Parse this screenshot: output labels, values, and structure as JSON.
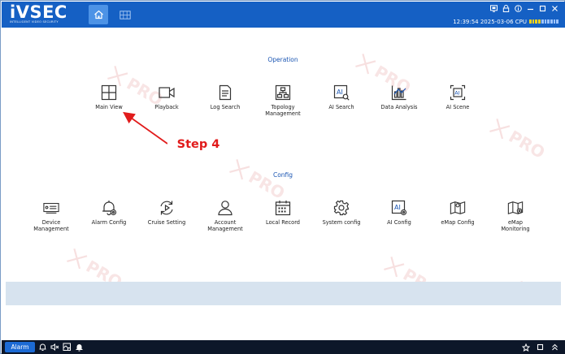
{
  "app": {
    "logo_text": "iVSEC",
    "logo_tagline": "INTELLIGENT VIDEO SECURITY",
    "time_text": "12:39:54 2025-03-06 CPU",
    "cpu_level": 0.4
  },
  "sections": {
    "operation": {
      "title": "Operation",
      "items": [
        {
          "label": "Main View",
          "icon": "main-view-icon"
        },
        {
          "label": "Playback",
          "icon": "playback-icon"
        },
        {
          "label": "Log Search",
          "icon": "log-search-icon"
        },
        {
          "label": "Topology\nManagement",
          "icon": "topology-icon"
        },
        {
          "label": "AI Search",
          "icon": "ai-search-icon"
        },
        {
          "label": "Data Analysis",
          "icon": "data-analysis-icon"
        },
        {
          "label": "AI Scene",
          "icon": "ai-scene-icon"
        }
      ]
    },
    "config": {
      "title": "Config",
      "items": [
        {
          "label": "Device\nManagement",
          "icon": "device-management-icon"
        },
        {
          "label": "Alarm Config",
          "icon": "alarm-config-icon"
        },
        {
          "label": "Cruise Setting",
          "icon": "cruise-setting-icon"
        },
        {
          "label": "Account\nManagement",
          "icon": "account-management-icon"
        },
        {
          "label": "Local Record",
          "icon": "local-record-icon"
        },
        {
          "label": "System config",
          "icon": "system-config-icon"
        },
        {
          "label": "AI Config",
          "icon": "ai-config-icon"
        },
        {
          "label": "eMap Config",
          "icon": "emap-config-icon"
        },
        {
          "label": "eMap\nMonitoring",
          "icon": "emap-monitoring-icon"
        }
      ]
    }
  },
  "annotation": {
    "text": "Step 4",
    "color": "#e11b1b"
  },
  "footer": {
    "alarm_label": "Alarm"
  },
  "colors": {
    "header_bg": "#1560c4",
    "accent": "#1b56b3",
    "footer_bg": "#0d1729"
  }
}
